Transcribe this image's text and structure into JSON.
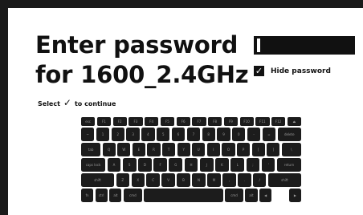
{
  "title_line1": "Enter password",
  "title_line2": "for 1600_2.4GHz",
  "password_cursor": "I",
  "hide_password": {
    "label": "Hide password",
    "checked": true
  },
  "instruction": {
    "before": "Select",
    "check_glyph": "✓",
    "after": "to continue"
  },
  "keyboard": {
    "rows": [
      [
        "esc",
        "F1",
        "F2",
        "F3",
        "F4",
        "F5",
        "F6",
        "F7",
        "F8",
        "F9",
        "F10",
        "F11",
        "F12",
        "⏏"
      ],
      [
        "~",
        "1",
        "2",
        "3",
        "4",
        "5",
        "6",
        "7",
        "8",
        "9",
        "0",
        "-",
        "=",
        "delete"
      ],
      [
        "tab",
        "Q",
        "W",
        "E",
        "R",
        "T",
        "Y",
        "U",
        "I",
        "O",
        "P",
        "[",
        "]",
        "\\"
      ],
      [
        "caps lock",
        "A",
        "S",
        "D",
        "F",
        "G",
        "H",
        "J",
        "K",
        "L",
        ";",
        "'",
        "return"
      ],
      [
        "shift",
        "Z",
        "X",
        "C",
        "V",
        "B",
        "N",
        "M",
        ",",
        ".",
        "/",
        "shift"
      ],
      [
        "fn",
        "ctrl",
        "alt",
        "cmd",
        "",
        "cmd",
        "alt",
        "◀",
        "▲▼",
        "▶"
      ]
    ]
  }
}
